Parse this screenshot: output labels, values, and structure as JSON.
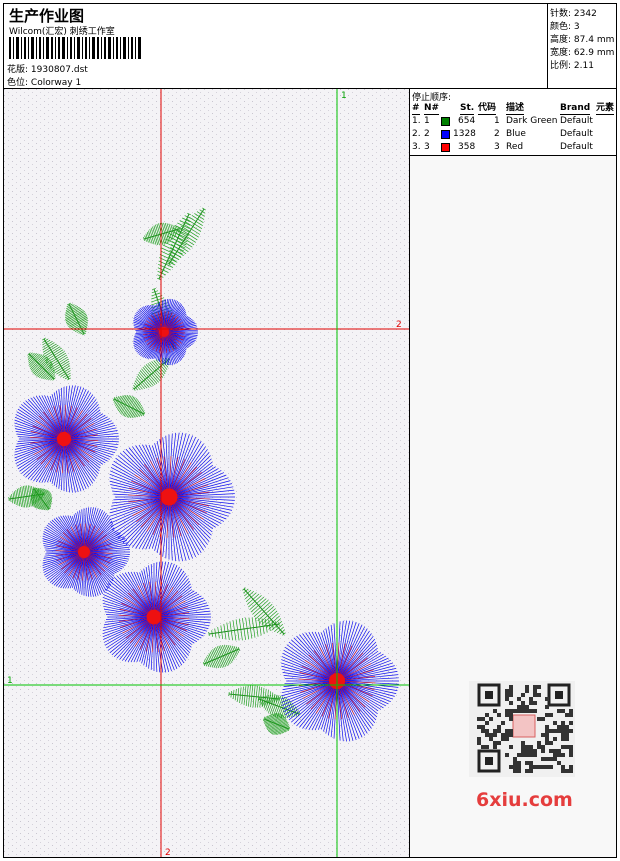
{
  "header": {
    "title": "生产作业图",
    "company": "Wilcom(汇宏) 刺绣工作室",
    "file_label": "花版:",
    "file_name": "1930807.dst",
    "colorway_label": "色位:",
    "colorway_name": "Colorway 1"
  },
  "stats": {
    "stitches_label": "针数:",
    "stitches_value": "2342",
    "colors_label": "颜色:",
    "colors_value": "3",
    "height_label": "高度:",
    "height_value": "87.4 mm",
    "width_label": "宽度:",
    "width_value": "62.9 mm",
    "scale_label": "比例:",
    "scale_value": "2.11"
  },
  "stop_sequence": {
    "title": "停止顺序:",
    "headers": {
      "hash": "#",
      "no": "N#",
      "st": "St.",
      "code": "代码",
      "desc": "描述",
      "brand": "Brand",
      "elements": "元素"
    },
    "rows": [
      {
        "hash": "1.",
        "no": "1",
        "color": "#008000",
        "st": "654",
        "code": "1",
        "desc": "Dark Green",
        "brand": "Default"
      },
      {
        "hash": "2.",
        "no": "2",
        "color": "#0000ff",
        "st": "1328",
        "code": "2",
        "desc": "Blue",
        "brand": "Default"
      },
      {
        "hash": "3.",
        "no": "3",
        "color": "#ff0000",
        "st": "358",
        "code": "3",
        "desc": "Red",
        "brand": "Default"
      }
    ]
  },
  "canvas": {
    "marker_h1": "1",
    "marker_h2": "2",
    "marker_v1": "1",
    "marker_v2": "2"
  },
  "watermark": {
    "text": "6xiu.com"
  },
  "colors": {
    "green_guide": "#00c000",
    "red_guide": "#e00000",
    "canvas_bg": "#f4f3f6"
  }
}
